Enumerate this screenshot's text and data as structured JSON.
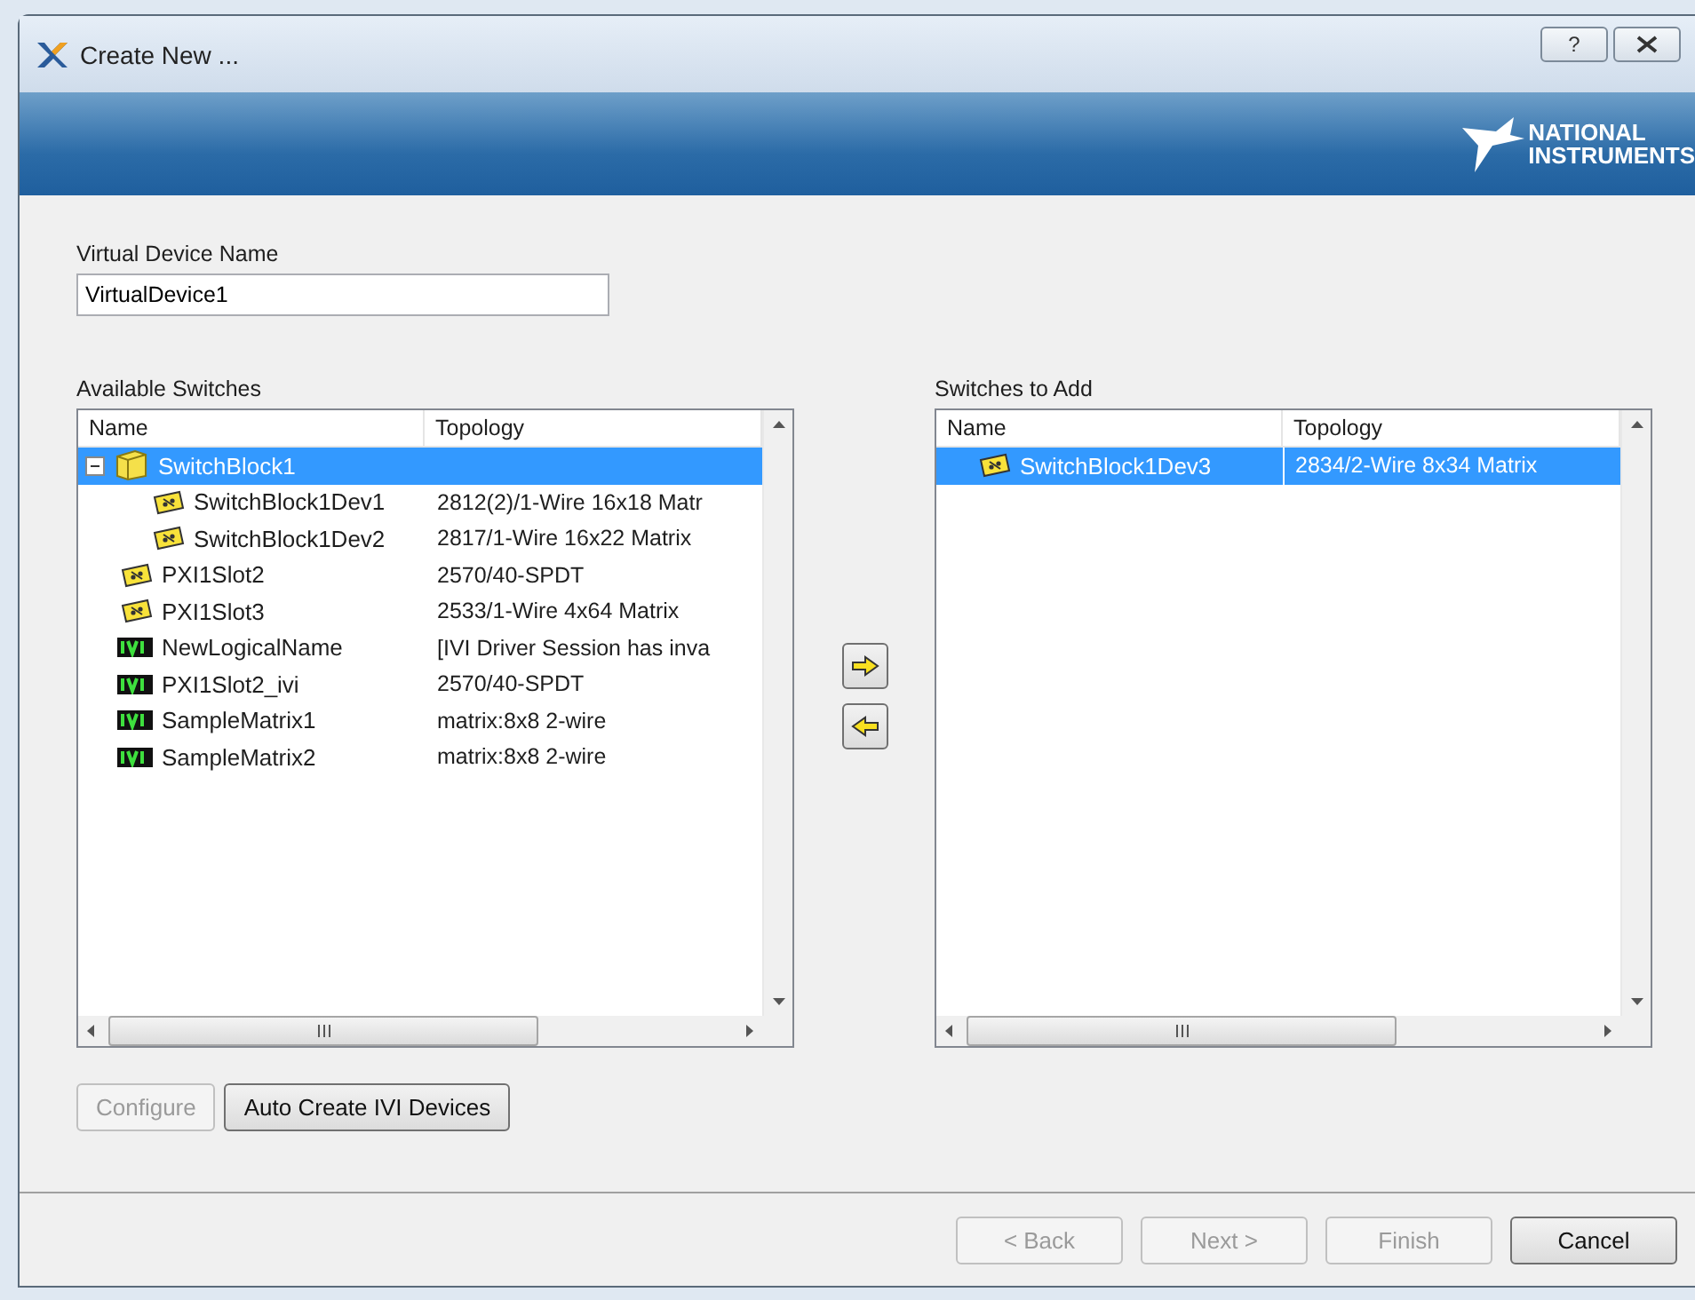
{
  "window": {
    "title": "Create New ...",
    "help_button": "?"
  },
  "banner": {
    "logo_lines": [
      "NATIONAL",
      "INSTRUMENTS"
    ]
  },
  "virtual_device": {
    "label": "Virtual Device Name",
    "value": "VirtualDevice1"
  },
  "available": {
    "label": "Available Switches",
    "columns": [
      "Name",
      "Topology"
    ],
    "items": [
      {
        "kind": "block",
        "name": "SwitchBlock1",
        "selected": true,
        "expanded": true,
        "children": [
          {
            "kind": "device",
            "name": "SwitchBlock1Dev1",
            "topology": "2812(2)/1-Wire 16x18 Matr",
            "selected": false
          },
          {
            "kind": "device",
            "name": "SwitchBlock1Dev2",
            "topology": "2817/1-Wire 16x22 Matrix",
            "selected": false
          }
        ]
      },
      {
        "kind": "device",
        "name": "PXI1Slot2",
        "topology": "2570/40-SPDT",
        "selected": false
      },
      {
        "kind": "device",
        "name": "PXI1Slot3",
        "topology": "2533/1-Wire 4x64 Matrix",
        "selected": false
      },
      {
        "kind": "ivi",
        "name": "NewLogicalName",
        "topology": "[IVI Driver Session has inva",
        "selected": false
      },
      {
        "kind": "ivi",
        "name": "PXI1Slot2_ivi",
        "topology": "2570/40-SPDT",
        "selected": false
      },
      {
        "kind": "ivi",
        "name": "SampleMatrix1",
        "topology": "matrix:8x8 2-wire",
        "selected": false
      },
      {
        "kind": "ivi",
        "name": "SampleMatrix2",
        "topology": "matrix:8x8 2-wire",
        "selected": false
      }
    ]
  },
  "to_add": {
    "label": "Switches to Add",
    "columns": [
      "Name",
      "Topology"
    ],
    "items": [
      {
        "kind": "device",
        "name": "SwitchBlock1Dev3",
        "topology": "2834/2-Wire 8x34 Matrix",
        "selected": true
      }
    ]
  },
  "list_buttons": [
    {
      "label": "Configure",
      "disabled": true
    },
    {
      "label": "Auto Create IVI Devices",
      "disabled": false
    }
  ],
  "wizard_buttons": [
    {
      "label": "< Back",
      "disabled": true
    },
    {
      "label": "Next >",
      "disabled": true
    },
    {
      "label": "Finish",
      "disabled": true
    },
    {
      "label": "Cancel",
      "disabled": false
    }
  ]
}
